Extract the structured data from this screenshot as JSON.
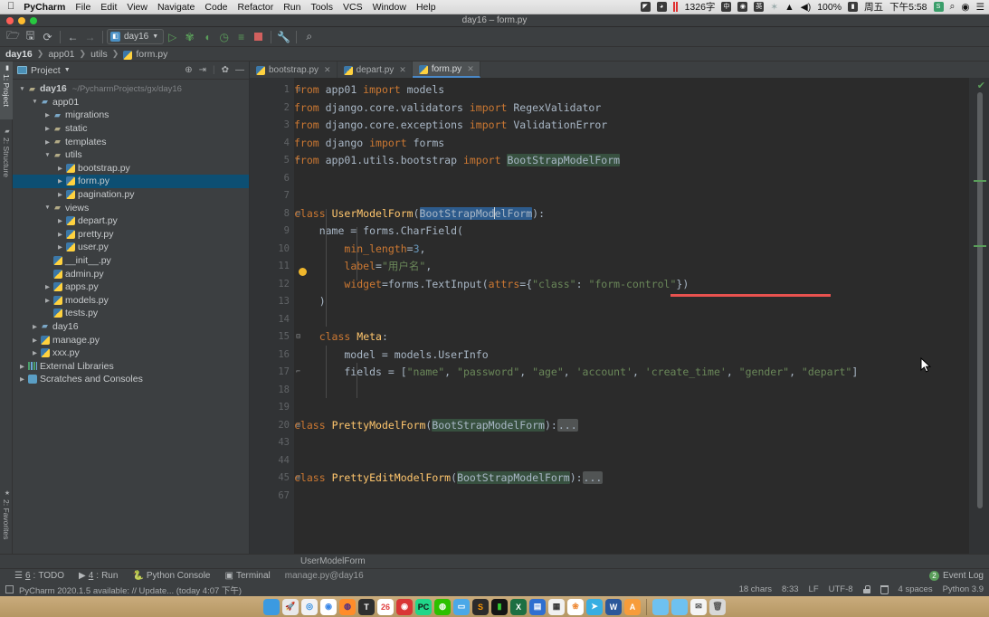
{
  "macbar": {
    "apple_icon": "apple-icon",
    "app_name": "PyCharm",
    "menus": [
      "File",
      "Edit",
      "View",
      "Navigate",
      "Code",
      "Refactor",
      "Run",
      "Tools",
      "VCS",
      "Window",
      "Help"
    ],
    "status_items": {
      "word_count": "1326字",
      "input_method_1": "中",
      "input_method_2": "英",
      "bluetooth_icon": "bluetooth-icon",
      "wifi_icon": "wifi-icon",
      "volume_icon": "volume-icon",
      "battery_percent": "100%",
      "battery_icon": "battery-icon",
      "day": "周五",
      "time": "下午5:58",
      "sougou_icon": "S",
      "spotlight_icon": "search-icon",
      "siri_icon": "siri-icon",
      "control_center_icon": "list-icon"
    }
  },
  "window": {
    "title": "day16 – form.py"
  },
  "toolbar": {
    "open_icon": "folder-open-icon",
    "save_icon": "save-icon",
    "sync_icon": "refresh-icon",
    "back_icon": "arrow-left-icon",
    "forward_icon": "arrow-right-icon",
    "run_config": "day16",
    "run_icon": "run-icon",
    "debug_icon": "debug-icon",
    "coverage_icon": "coverage-icon",
    "profile_icon": "profile-icon",
    "run_with_icon": "run-with-console-icon",
    "stop_icon": "stop-icon",
    "settings_icon": "wrench-icon",
    "search_icon": "search-icon"
  },
  "breadcrumb": {
    "items": [
      "day16",
      "app01",
      "utils",
      "form.py"
    ]
  },
  "left_strip": {
    "project_label": "1: Project",
    "structure_label": "2: Structure",
    "favorites_label": "2: Favorites"
  },
  "project_panel": {
    "title": "Project",
    "dropdown_icon": "chevron-down-icon",
    "locate_icon": "target-icon",
    "collapse_icon": "collapse-all-icon",
    "settings_icon": "gear-icon",
    "hide_icon": "minimize-icon",
    "tree": [
      {
        "label": "day16",
        "hint": "~/PycharmProjects/gx/day16",
        "depth": 0,
        "arrow": "▼",
        "icon": "folder",
        "selected": false
      },
      {
        "label": "app01",
        "hint": "",
        "depth": 1,
        "arrow": "▼",
        "icon": "folder-django",
        "selected": false
      },
      {
        "label": "migrations",
        "hint": "",
        "depth": 2,
        "arrow": "▶",
        "icon": "folder-django",
        "selected": false
      },
      {
        "label": "static",
        "hint": "",
        "depth": 2,
        "arrow": "▶",
        "icon": "folder",
        "selected": false
      },
      {
        "label": "templates",
        "hint": "",
        "depth": 2,
        "arrow": "▶",
        "icon": "folder",
        "selected": false
      },
      {
        "label": "utils",
        "hint": "",
        "depth": 2,
        "arrow": "▼",
        "icon": "folder",
        "selected": false
      },
      {
        "label": "bootstrap.py",
        "hint": "",
        "depth": 3,
        "arrow": "▶",
        "icon": "python",
        "selected": false
      },
      {
        "label": "form.py",
        "hint": "",
        "depth": 3,
        "arrow": "▶",
        "icon": "python",
        "selected": true
      },
      {
        "label": "pagination.py",
        "hint": "",
        "depth": 3,
        "arrow": "▶",
        "icon": "python",
        "selected": false
      },
      {
        "label": "views",
        "hint": "",
        "depth": 2,
        "arrow": "▼",
        "icon": "folder",
        "selected": false
      },
      {
        "label": "depart.py",
        "hint": "",
        "depth": 3,
        "arrow": "▶",
        "icon": "python",
        "selected": false
      },
      {
        "label": "pretty.py",
        "hint": "",
        "depth": 3,
        "arrow": "▶",
        "icon": "python",
        "selected": false
      },
      {
        "label": "user.py",
        "hint": "",
        "depth": 3,
        "arrow": "▶",
        "icon": "python",
        "selected": false
      },
      {
        "label": "__init__.py",
        "hint": "",
        "depth": 2,
        "arrow": "",
        "icon": "python",
        "selected": false
      },
      {
        "label": "admin.py",
        "hint": "",
        "depth": 2,
        "arrow": "",
        "icon": "python",
        "selected": false
      },
      {
        "label": "apps.py",
        "hint": "",
        "depth": 2,
        "arrow": "▶",
        "icon": "python",
        "selected": false
      },
      {
        "label": "models.py",
        "hint": "",
        "depth": 2,
        "arrow": "▶",
        "icon": "python",
        "selected": false
      },
      {
        "label": "tests.py",
        "hint": "",
        "depth": 2,
        "arrow": "",
        "icon": "python",
        "selected": false
      },
      {
        "label": "day16",
        "hint": "",
        "depth": 1,
        "arrow": "▶",
        "icon": "folder-django",
        "selected": false
      },
      {
        "label": "manage.py",
        "hint": "",
        "depth": 1,
        "arrow": "▶",
        "icon": "python",
        "selected": false
      },
      {
        "label": "xxx.py",
        "hint": "",
        "depth": 1,
        "arrow": "▶",
        "icon": "python",
        "selected": false
      },
      {
        "label": "External Libraries",
        "hint": "",
        "depth": 0,
        "arrow": "▶",
        "icon": "library",
        "selected": false
      },
      {
        "label": "Scratches and Consoles",
        "hint": "",
        "depth": 0,
        "arrow": "▶",
        "icon": "scratch",
        "selected": false
      }
    ]
  },
  "editor": {
    "tabs": [
      {
        "label": "bootstrap.py",
        "active": false
      },
      {
        "label": "depart.py",
        "active": false
      },
      {
        "label": "form.py",
        "active": true
      }
    ],
    "line_numbers": [
      "1",
      "2",
      "3",
      "4",
      "5",
      "6",
      "7",
      "8",
      "9",
      "10",
      "11",
      "12",
      "13",
      "14",
      "15",
      "16",
      "17",
      "18",
      "19",
      "20",
      "43",
      "44",
      "45",
      "67"
    ],
    "code_lines": [
      "from app01 import models",
      "from django.core.validators import RegexValidator",
      "from django.core.exceptions import ValidationError",
      "from django import forms",
      "from app01.utils.bootstrap import BootStrapModelForm",
      "",
      "",
      "class UserModelForm(BootStrapModelForm):",
      "    name = forms.CharField(",
      "        min_length=3,",
      "        label=\"用户名\",",
      "        widget=forms.TextInput(attrs={\"class\": \"form-control\"})",
      "    )",
      "",
      "    class Meta:",
      "        model = models.UserInfo",
      "        fields = [\"name\", \"password\", \"age\", 'account', 'create_time', \"gender\", \"depart\"]",
      "",
      "",
      "class PrettyModelForm(BootStrapModelForm):...",
      "",
      "",
      "class PrettyEditModelForm(BootStrapModelForm):...",
      ""
    ],
    "selected_token": "BootStrapModelForm",
    "inspection_ok_icon": "checkmark-icon",
    "bulb_icon": "intention-bulb-icon"
  },
  "editor_breadcrumb": {
    "label": "UserModelForm"
  },
  "bottom_tools": {
    "todo": {
      "num": "6",
      "label": "TODO",
      "icon": "todo-icon"
    },
    "run": {
      "num": "4",
      "label": "Run",
      "icon": "run-icon"
    },
    "python_console": {
      "label": "Python Console",
      "icon": "python-console-icon"
    },
    "terminal": {
      "label": "Terminal",
      "icon": "terminal-icon"
    },
    "context": "manage.py@day16",
    "event_log": {
      "label": "Event Log",
      "count": "2"
    }
  },
  "statusbar": {
    "notification": "PyCharm 2020.1.5 available: // Update... (today 4:07 下午)",
    "chars": "18 chars",
    "caret": "8:33",
    "line_sep": "LF",
    "encoding": "UTF-8",
    "lock_icon": "lock-icon",
    "trash_icon": "trash-icon",
    "indent": "4 spaces",
    "interpreter": "Python 3.9"
  },
  "dock": {
    "items": [
      {
        "name": "finder",
        "glyph": "",
        "bg": "#3b9ae1",
        "fg": "#fff"
      },
      {
        "name": "launchpad",
        "glyph": "🚀",
        "bg": "#e8e8ea",
        "fg": "#444"
      },
      {
        "name": "safari",
        "glyph": "◎",
        "bg": "#f2f2f4",
        "fg": "#2b8ae0"
      },
      {
        "name": "chrome",
        "glyph": "◉",
        "bg": "#ffffff",
        "fg": "#3a87e8"
      },
      {
        "name": "firefox",
        "glyph": "◍",
        "bg": "#ff8c2a",
        "fg": "#4a2a86"
      },
      {
        "name": "typora",
        "glyph": "T",
        "bg": "#2f2f2f",
        "fg": "#fff"
      },
      {
        "name": "calendar",
        "glyph": "26",
        "bg": "#ffffff",
        "fg": "#e04040"
      },
      {
        "name": "netease-music",
        "glyph": "◉",
        "bg": "#d93636",
        "fg": "#fff"
      },
      {
        "name": "pycharm",
        "glyph": "PC",
        "bg": "#21d789",
        "fg": "#111"
      },
      {
        "name": "wechat",
        "glyph": "◍",
        "bg": "#2dc100",
        "fg": "#fff"
      },
      {
        "name": "keynote",
        "glyph": "▭",
        "bg": "#4aa8e8",
        "fg": "#fff"
      },
      {
        "name": "sublime-text",
        "glyph": "S",
        "bg": "#2b2b2b",
        "fg": "#ff9800"
      },
      {
        "name": "iterm",
        "glyph": "▮",
        "bg": "#151515",
        "fg": "#33cc33"
      },
      {
        "name": "excel",
        "glyph": "X",
        "bg": "#1d6f42",
        "fg": "#fff"
      },
      {
        "name": "remote-desktop",
        "glyph": "▤",
        "bg": "#2f6fd0",
        "fg": "#fff"
      },
      {
        "name": "screenshot",
        "glyph": "▦",
        "bg": "#f0f0f0",
        "fg": "#333"
      },
      {
        "name": "photos",
        "glyph": "❀",
        "bg": "#ffffff",
        "fg": "#ee8833"
      },
      {
        "name": "telegram",
        "glyph": "➤",
        "bg": "#37aee2",
        "fg": "#fff"
      },
      {
        "name": "word",
        "glyph": "W",
        "bg": "#2b579a",
        "fg": "#fff"
      },
      {
        "name": "app-store",
        "glyph": "A",
        "bg": "#f79c3a",
        "fg": "#fff"
      }
    ],
    "right_items": [
      {
        "name": "documents-folder",
        "glyph": "",
        "bg": "#6ec1f0",
        "fg": "#fff"
      },
      {
        "name": "downloads-folder",
        "glyph": "",
        "bg": "#6ec1f0",
        "fg": "#fff"
      },
      {
        "name": "mail-stack",
        "glyph": "✉",
        "bg": "#f4f4f4",
        "fg": "#555"
      },
      {
        "name": "trash",
        "glyph": "🗑",
        "bg": "#d8d8d8",
        "fg": "#555"
      }
    ]
  }
}
